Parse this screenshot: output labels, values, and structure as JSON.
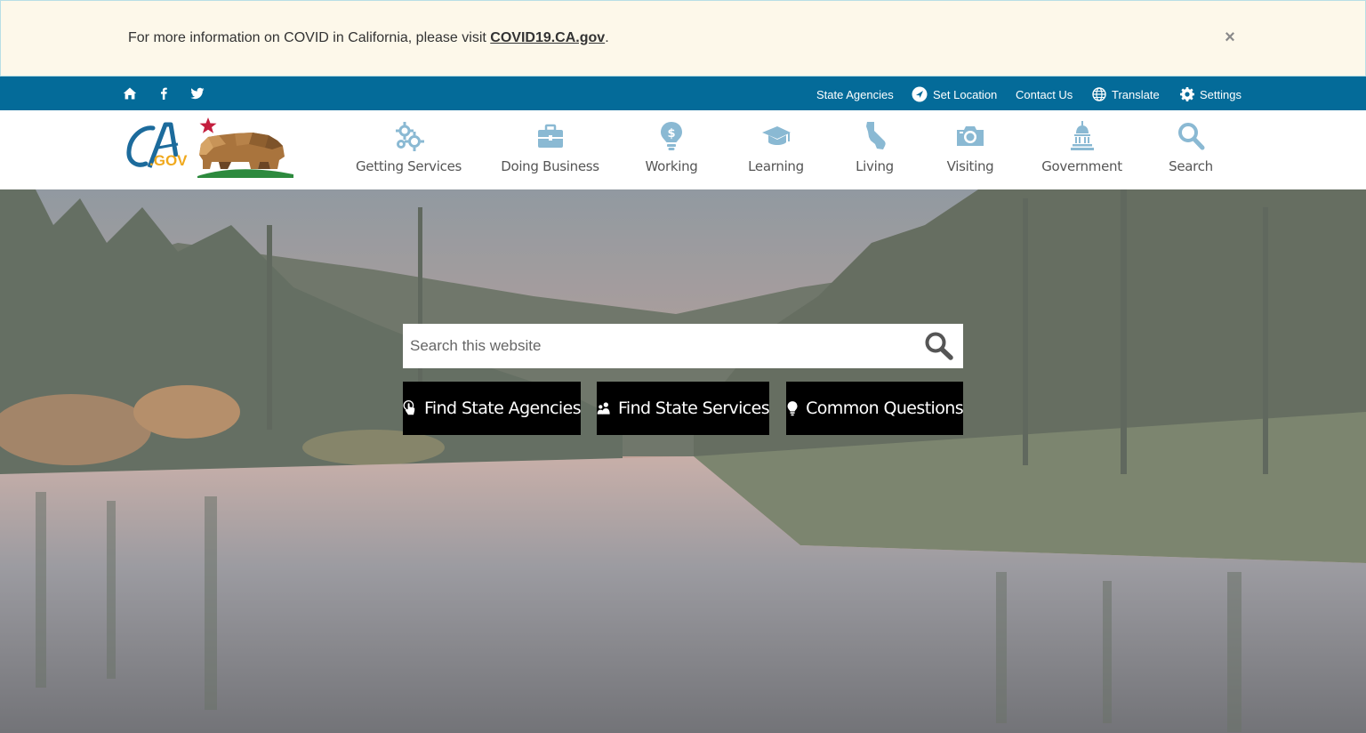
{
  "alert": {
    "text": "For more information on COVID in California, please visit ",
    "link_label": "COVID19.CA.gov",
    "suffix": ".",
    "close_label": "×"
  },
  "utility": {
    "social_icons": [
      "home-icon",
      "facebook-icon",
      "twitter-icon"
    ],
    "links": {
      "state_agencies": "State Agencies",
      "set_location": "Set Location",
      "contact_us": "Contact Us",
      "translate": "Translate",
      "settings": "Settings"
    },
    "bar_color": "#046b99"
  },
  "header": {
    "logo_text": "CA.GOV",
    "nav": [
      {
        "label": "Getting Services",
        "icon": "gears-icon"
      },
      {
        "label": "Doing Business",
        "icon": "briefcase-icon"
      },
      {
        "label": "Working",
        "icon": "money-bulb-icon"
      },
      {
        "label": "Learning",
        "icon": "graduation-cap-icon"
      },
      {
        "label": "Living",
        "icon": "california-icon"
      },
      {
        "label": "Visiting",
        "icon": "camera-icon"
      },
      {
        "label": "Government",
        "icon": "capitol-icon"
      },
      {
        "label": "Search",
        "icon": "search-icon"
      }
    ],
    "nav_icon_color": "#7fb3cf"
  },
  "hero": {
    "search_placeholder": "Search this website",
    "buttons": {
      "find_agencies": "Find State Agencies",
      "find_services": "Find State Services",
      "common_questions": "Common Questions"
    }
  }
}
